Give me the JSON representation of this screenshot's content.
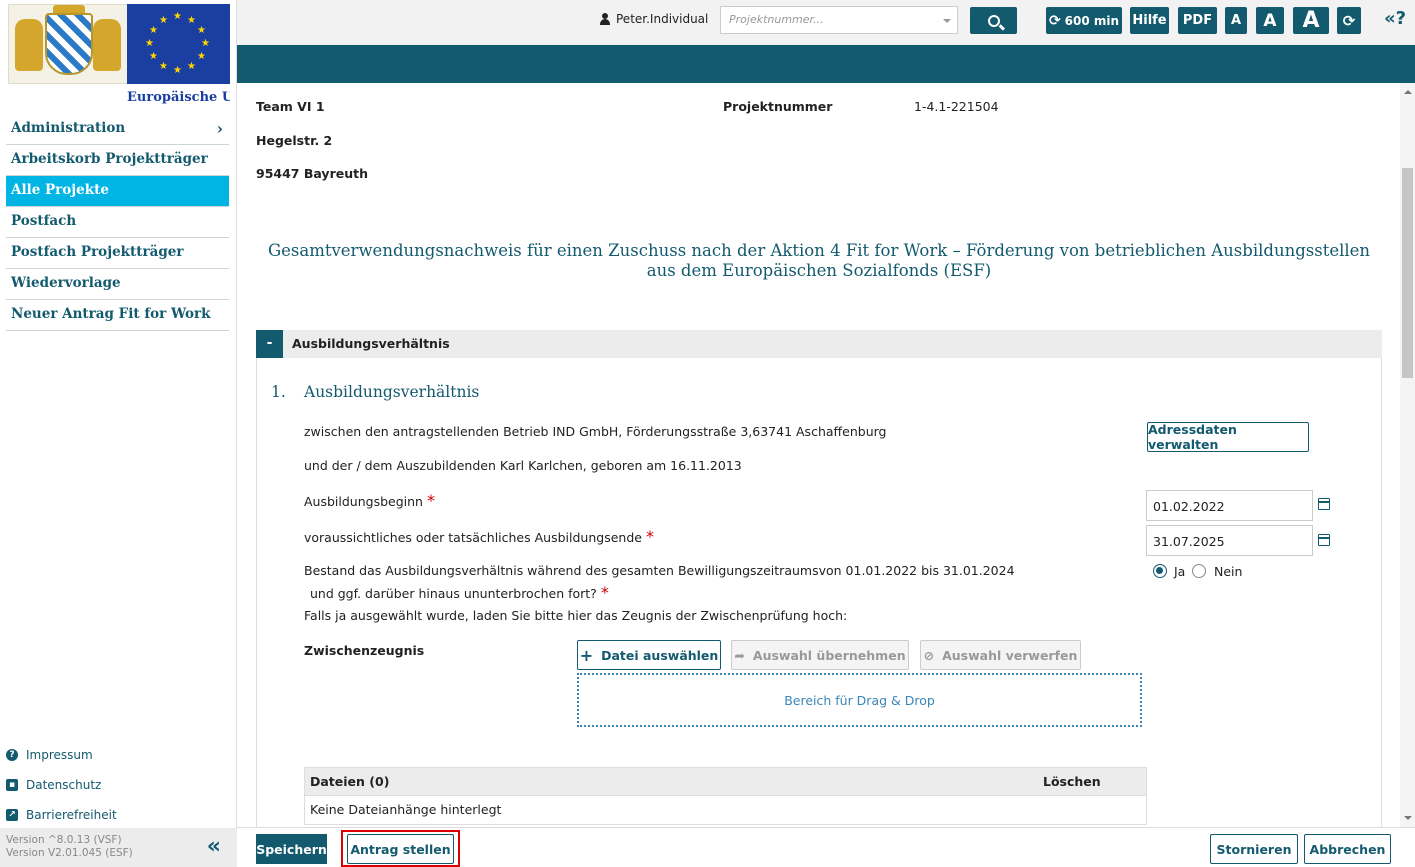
{
  "sidebar": {
    "eu_label": "Europäische Uni",
    "nav": [
      {
        "label": "Administration",
        "has_chevron": true
      },
      {
        "label": "Arbeitskorb Projektträger"
      },
      {
        "label": "Alle Projekte",
        "active": true
      },
      {
        "label": "Postfach"
      },
      {
        "label": "Postfach Projektträger"
      },
      {
        "label": "Wiedervorlage"
      },
      {
        "label": "Neuer Antrag Fit for Work"
      }
    ],
    "footer_links": [
      "Impressum",
      "Datenschutz",
      "Barrierefreiheit"
    ],
    "version_vsf": "Version ^8.0.13 (VSF)",
    "version_esf": "Version V2.01.045 (ESF)"
  },
  "topbar": {
    "user": "Peter.Individual",
    "project_placeholder": "Projektnummer...",
    "timer": "600 min",
    "help": "Hilfe",
    "pdf": "PDF",
    "font_small": "A",
    "font_medium": "A",
    "font_large": "A"
  },
  "header": {
    "team": "Team VI 1",
    "street": "Hegelstr. 2",
    "city": "95447 Bayreuth",
    "project_label": "Projektnummer",
    "project_number": "1-4.1-221504"
  },
  "document_title": "Gesamtverwendungsnachweis für einen Zuschuss nach der Aktion 4 Fit for Work – Förderung von betrieblichen Ausbildungsstellen aus dem Europäischen Sozialfonds (ESF)",
  "section": {
    "toggle": "-",
    "title": "Ausbildungsverhältnis",
    "sub_number": "1.",
    "sub_title": "Ausbildungsverhältnis",
    "company_line": "zwischen den antragstellenden Betrieb  IND GmbH,  Förderungsstraße 3,63741  Aschaffenburg",
    "trainee_line": "und der / dem Auszubildenden  Karl  Karlchen, geboren am  16.11.2013",
    "manage_address_btn": "Adressdaten verwalten",
    "start_label": "Ausbildungsbeginn",
    "start_value": "01.02.2022",
    "end_label": "voraussichtliches oder tatsächliches Ausbildungsende",
    "end_value": "31.07.2025",
    "question_line1": "Bestand das Ausbildungsverhältnis während des gesamten Bewilligungszeitraumsvon  01.01.2022  bis  31.01.2024",
    "question_line2": "und ggf. darüber hinaus ununterbrochen fort?",
    "yes": "Ja",
    "no": "Nein",
    "selected": "Ja",
    "upload_hint": "Falls ja ausgewählt wurde, laden Sie bitte hier das Zeugnis der Zwischenprüfung hoch:",
    "upload_label": "Zwischenzeugnis",
    "choose_file_btn": "Datei auswählen",
    "apply_selection_btn": "Auswahl übernehmen",
    "discard_selection_btn": "Auswahl verwerfen",
    "dropzone": "Bereich für Drag & Drop",
    "files_header": "Dateien (0)",
    "delete_header": "Löschen",
    "no_files": "Keine Dateianhänge hinterlegt"
  },
  "bottombar": {
    "save": "Speichern",
    "submit": "Antrag stellen",
    "cancel": "Stornieren",
    "abort": "Abbrechen"
  },
  "colors": {
    "primary": "#135a6e",
    "active_nav": "#00b4e3",
    "required": "#cc0000",
    "highlight": "#dd0000"
  }
}
